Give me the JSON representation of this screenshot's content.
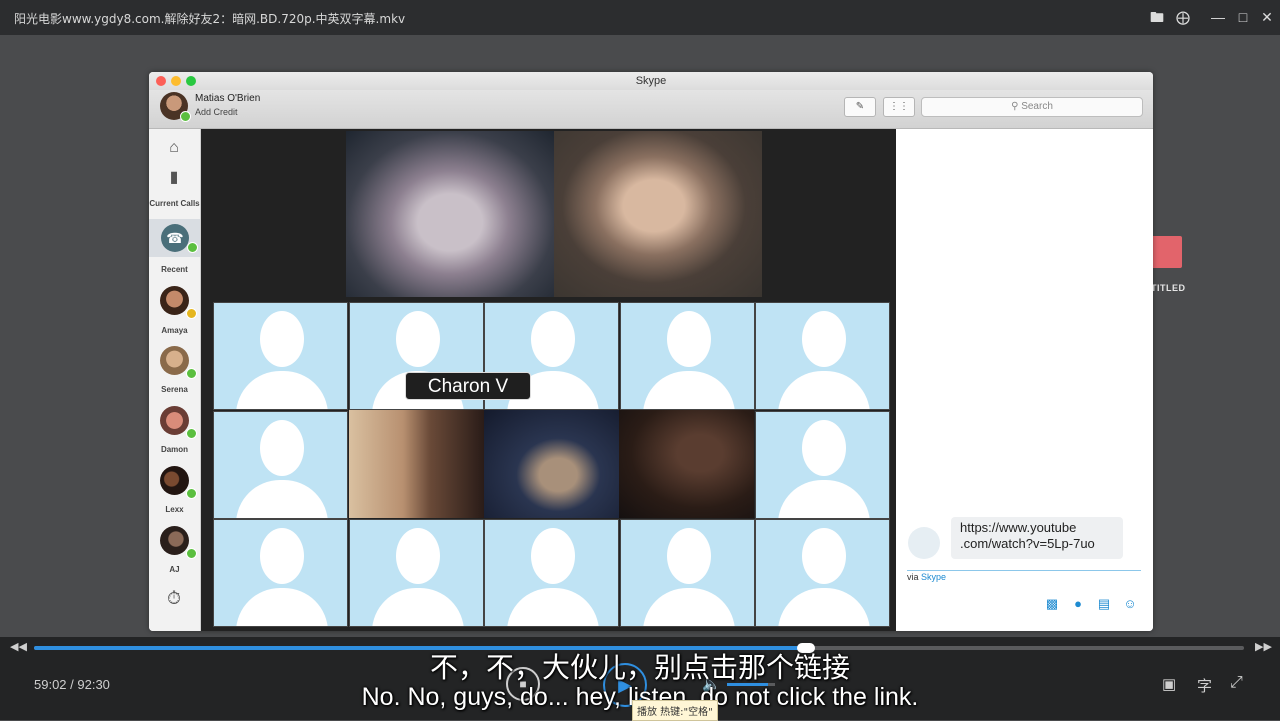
{
  "player": {
    "window_title": "阳光电影www.ygdy8.com.解除好友2：暗网.BD.720p.中英双字幕.mkv",
    "time_display": "59:02 / 92:30",
    "progress": 0.638,
    "volume": 0.85,
    "tooltip": "播放 热键:\"空格\"",
    "subtitle_zh": "不，不，大伙儿，别点击那个链接",
    "subtitle_en": "No. No, guys, do... hey, listen, do not click the link.",
    "subtitle_btn": "字",
    "bg_label": "TITLED"
  },
  "skype": {
    "app_title": "Skype",
    "user_name": "Matias O'Brien",
    "user_sub": "Add Credit",
    "search_placeholder": "Search",
    "sidebar": {
      "current_calls": "Current Calls",
      "recent": "Recent",
      "contacts": [
        "Amaya",
        "Serena",
        "Damon",
        "Lexx",
        "AJ"
      ]
    },
    "call_label": "Charon V",
    "chat": {
      "message": "https://www.youtube .com/watch?v=5Lp-7uo",
      "via": "via",
      "via_link": "Skype"
    }
  },
  "colors": {
    "accent": "#2f8fe0",
    "online": "#5bbf3f",
    "placeholder_bg": "#bfe3f4"
  }
}
